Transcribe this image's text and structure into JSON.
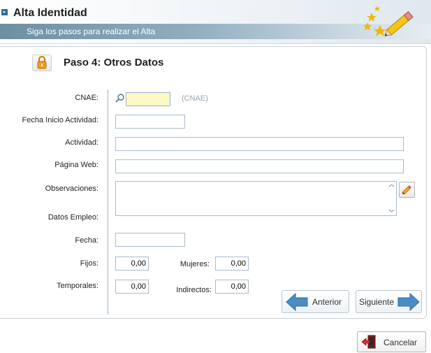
{
  "header": {
    "title": "Alta Identidad",
    "subtitle": "Siga los pasos para realizar el Alta"
  },
  "step": {
    "title": "Paso 4: Otros Datos"
  },
  "form": {
    "cnae": {
      "label": "CNAE:",
      "value": "",
      "hint": "(CNAE)"
    },
    "fecha_inicio": {
      "label": "Fecha Inicio Actividad:",
      "value": ""
    },
    "actividad": {
      "label": "Actividad:",
      "value": ""
    },
    "pagina_web": {
      "label": "Página Web:",
      "value": ""
    },
    "observaciones": {
      "label": "Observaciones:",
      "value": ""
    },
    "datos_empleo": {
      "label": "Datos Empleo:"
    },
    "fecha": {
      "label": "Fecha:",
      "value": ""
    },
    "fijos": {
      "label": "Fijos:",
      "value": "0,00"
    },
    "mujeres": {
      "label": "Mujeres:",
      "value": "0,00"
    },
    "temporales": {
      "label": "Temporales:",
      "value": "0,00"
    },
    "indirectos": {
      "label": "Indirectos:",
      "value": "0,00"
    }
  },
  "buttons": {
    "anterior": "Anterior",
    "siguiente": "Siguiente",
    "cancelar": "Cancelar"
  },
  "icons": {
    "header_bullet": "expand-icon",
    "header_decoration": "stars-pencil-icon",
    "step": "lock-icon",
    "cnae_search": "search-icon",
    "observaciones_edit": "pencil-icon",
    "anterior": "arrow-left-icon",
    "siguiente": "arrow-right-icon",
    "cancelar": "exit-door-icon"
  },
  "colors": {
    "header_band": "#7f9fb2",
    "field_border": "#a9bccd",
    "cnae_highlight": "#fdf8c4",
    "arrow_blue": "#4a8cc4"
  }
}
